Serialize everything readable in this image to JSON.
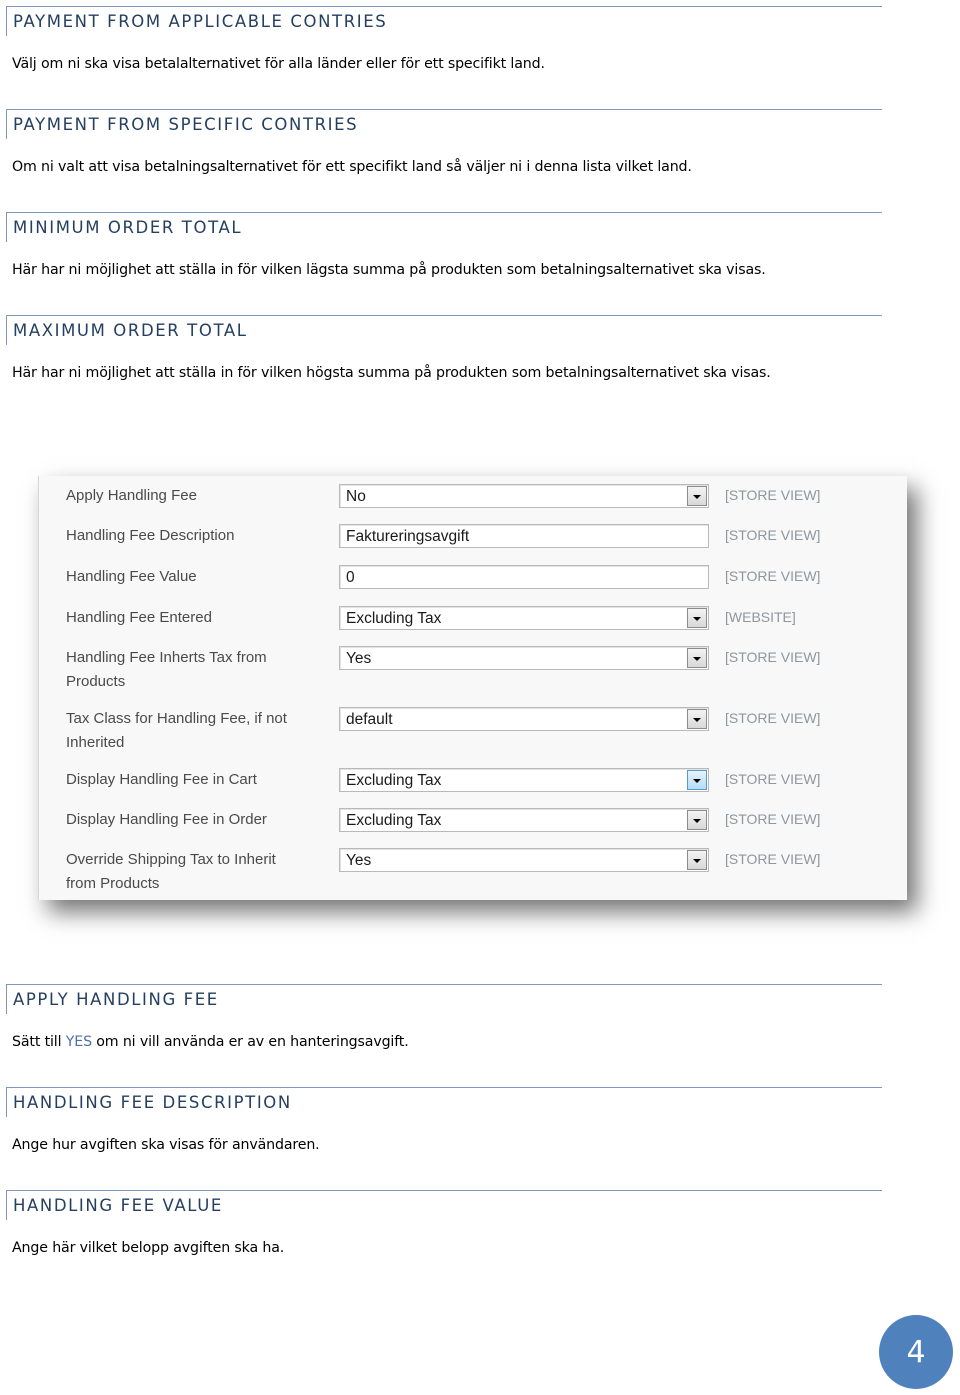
{
  "sections_top": [
    {
      "title": "PAYMENT FROM APPLICABLE CONTRIES",
      "body": "Välj om ni ska visa betalalternativet för alla länder eller för ett specifikt land."
    },
    {
      "title": "PAYMENT FROM SPECIFIC CONTRIES",
      "body": "Om ni valt att visa betalningsalternativet för ett specifikt land så väljer ni i denna lista vilket land."
    },
    {
      "title": "MINIMUM ORDER TOTAL",
      "body": "Här har ni möjlighet att ställa in för vilken lägsta summa på produkten som betalningsalternativet ska visas."
    },
    {
      "title": "MAXIMUM ORDER TOTAL",
      "body": "Här har ni möjlighet att ställa in för vilken högsta summa på produkten som betalningsalternativet ska visas."
    }
  ],
  "settings_panel": {
    "rows": [
      {
        "label": "Apply Handling Fee",
        "value": "No",
        "control": "select",
        "scope": "[STORE VIEW]"
      },
      {
        "label": "Handling Fee Description",
        "value": "Faktureringsavgift",
        "control": "text",
        "scope": "[STORE VIEW]"
      },
      {
        "label": "Handling Fee Value",
        "value": "0",
        "control": "text",
        "scope": "[STORE VIEW]"
      },
      {
        "label": "Handling Fee Entered",
        "value": "Excluding Tax",
        "control": "select",
        "scope": "[WEBSITE]"
      },
      {
        "label": "Handling Fee Inherts Tax from Products",
        "value": "Yes",
        "control": "select",
        "scope": "[STORE VIEW]"
      },
      {
        "label": "Tax Class for Handling Fee, if not Inherited",
        "value": "default",
        "control": "select",
        "scope": "[STORE VIEW]"
      },
      {
        "label": "Display Handling Fee in Cart",
        "value": "Excluding Tax",
        "control": "select",
        "scope": "[STORE VIEW]",
        "hover": true
      },
      {
        "label": "Display Handling Fee in Order",
        "value": "Excluding Tax",
        "control": "select",
        "scope": "[STORE VIEW]"
      },
      {
        "label": "Override Shipping Tax to Inherit from Products",
        "value": "Yes",
        "control": "select",
        "scope": "[STORE VIEW]"
      }
    ]
  },
  "sections_bottom": [
    {
      "title": "APPLY HANDLING FEE",
      "body_pre": "Sätt till ",
      "body_accent": "YES",
      "body_post": " om ni vill använda er av en hanteringsavgift."
    },
    {
      "title": "HANDLING FEE DESCRIPTION",
      "body": "Ange hur avgiften ska visas för användaren."
    },
    {
      "title": "HANDLING FEE VALUE",
      "body": "Ange här vilket belopp avgiften ska ha."
    }
  ],
  "page_number": "4",
  "colors": {
    "heading": "#243f60",
    "rule": "#7f98bb",
    "badge": "#4f81bd",
    "accent": "#4f6fa8"
  }
}
